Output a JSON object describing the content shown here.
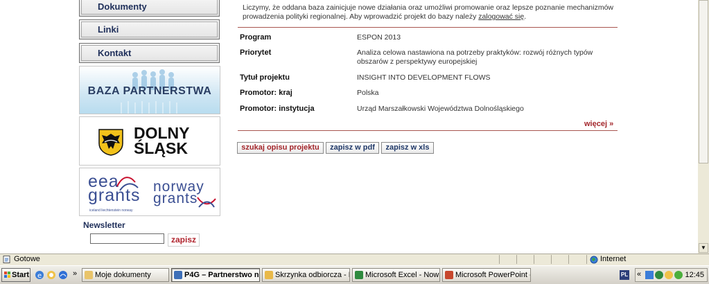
{
  "sidebar": {
    "nav": [
      {
        "label": "Dokumenty"
      },
      {
        "label": "Linki"
      },
      {
        "label": "Kontakt"
      }
    ],
    "banners": {
      "baza": "BAZA PARTNERSTWA",
      "dolny_line1": "DOLNY",
      "dolny_line2": "ŚLĄSK",
      "eea_line1": "eea",
      "eea_line2": "grants",
      "eea_sub": "iceland liechtenstein norway",
      "norway_line1": "norway",
      "norway_line2": "grants"
    },
    "newsletter": {
      "label": "Newsletter",
      "input_value": "",
      "button": "zapisz"
    }
  },
  "main": {
    "intro_text": "Liczymy, że oddana baza zainicjuje nowe działania oraz umożliwi promowanie oraz lepsze poznanie mechanizmów prowadzenia polityki regionalnej. Aby wprowadzić projekt do bazy należy ",
    "intro_link": "zalogować się",
    "intro_end": ".",
    "rows": [
      {
        "label": "Program",
        "value": "ESPON 2013"
      },
      {
        "label": "Priorytet",
        "value": "Analiza celowa nastawiona na potrzeby praktyków: rozwój różnych typów obszarów z perspektywy europejskiej"
      },
      {
        "label": "Tytuł projektu",
        "value": "INSIGHT INTO DEVELOPMENT FLOWS"
      },
      {
        "label": "Promotor: kraj",
        "value": "Polska"
      },
      {
        "label": "Promotor: instytucja",
        "value": "Urząd Marszałkowski Województwa Dolnośląskiego"
      }
    ],
    "more_link": "więcej »",
    "buttons": {
      "search": "szukaj opisu projektu",
      "pdf": "zapisz w pdf",
      "xls": "zapisz w xls"
    }
  },
  "statusbar": {
    "status": "Gotowe",
    "zone": "Internet"
  },
  "taskbar": {
    "start": "Start",
    "chevron": "»",
    "tasks": [
      {
        "label": "Moje dokumenty",
        "icon_color": "#e9c46a"
      },
      {
        "label": "P4G – Partnerstwo na...",
        "icon_color": "#3d6fb8"
      },
      {
        "label": "Skrzynka odbiorcza - Mic...",
        "icon_color": "#e9b949"
      },
      {
        "label": "Microsoft Excel - Nowa A...",
        "icon_color": "#2f8a3e"
      },
      {
        "label": "Microsoft PowerPoint - [...",
        "icon_color": "#c7472c"
      }
    ],
    "lang": "PL",
    "tray_chevron": "«",
    "clock": "12:45"
  },
  "colors": {
    "accent_red": "#a3262b",
    "nav_text": "#1f2f5a",
    "divider": "#a8554f"
  }
}
